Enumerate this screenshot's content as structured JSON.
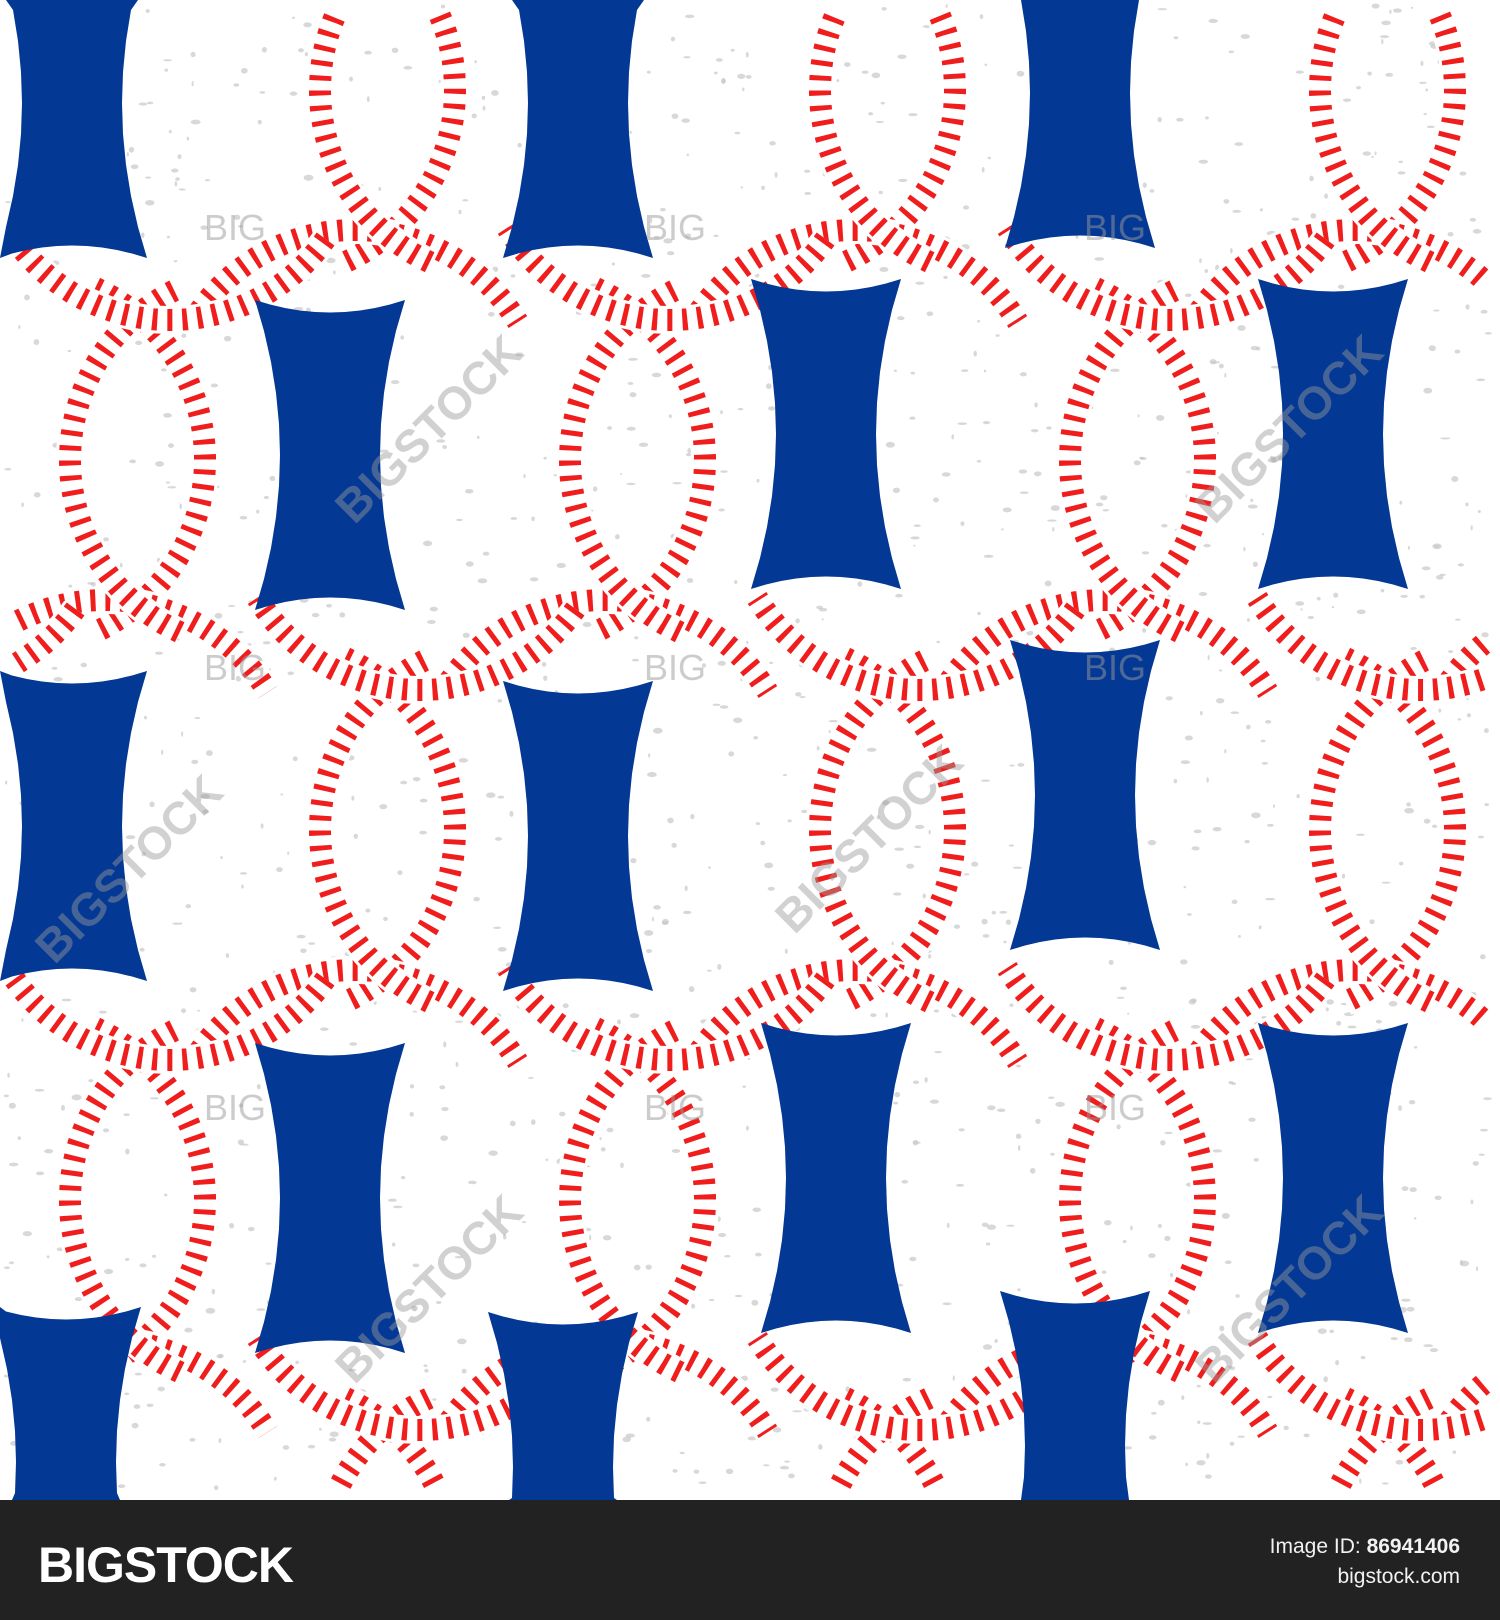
{
  "image": {
    "colors": {
      "blue": "#033895",
      "red": "#f01d1d",
      "background": "#ffffff",
      "speckle": "#c8c8c8"
    },
    "watermark_texts": [
      "BIGSTOCK",
      "BIG"
    ]
  },
  "footer": {
    "logo": "BIGSTOCK",
    "image_id_label": "Image ID:",
    "image_id": "86941406",
    "site": "bigstock.com"
  }
}
